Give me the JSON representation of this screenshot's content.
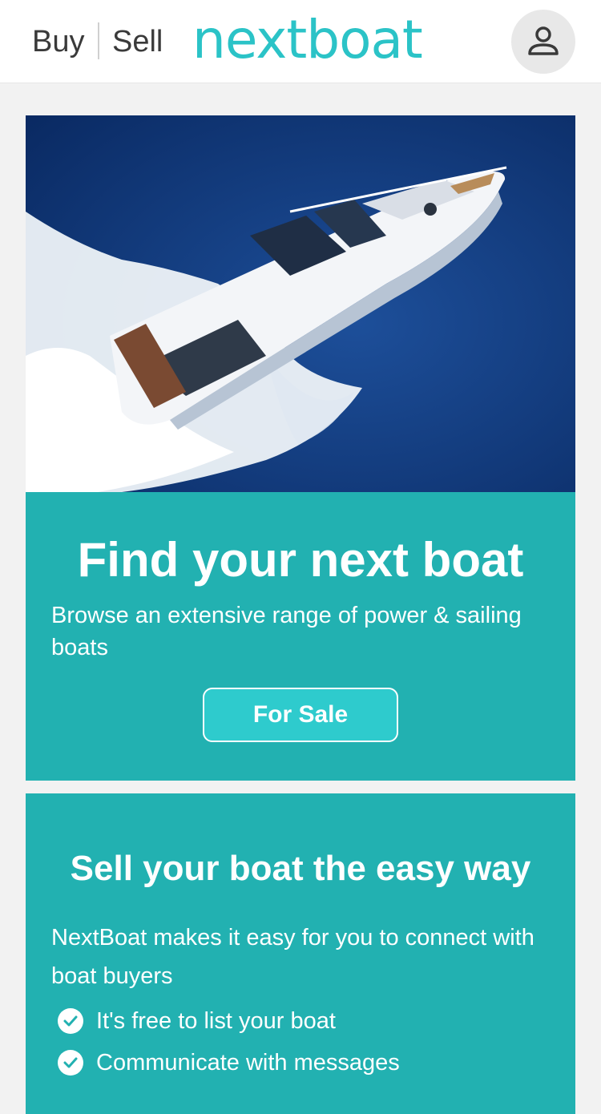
{
  "header": {
    "buy_label": "Buy",
    "sell_label": "Sell",
    "logo_text": "nextboat",
    "profile_icon": "user-icon"
  },
  "hero": {
    "image_icon": "motor-yacht-photo",
    "title": "Find your next boat",
    "subtitle": "Browse an extensive range of power & sailing boats",
    "button_label": "For Sale"
  },
  "sell": {
    "title": "Sell your boat the easy way",
    "subtitle": "NextBoat makes it easy for you to connect with boat buyers",
    "bullets": [
      "It's free to list your boat",
      "Communicate with messages"
    ]
  },
  "colors": {
    "brand": "#2bc3c7",
    "card": "#22b1b1",
    "button": "#2ecbcd"
  }
}
